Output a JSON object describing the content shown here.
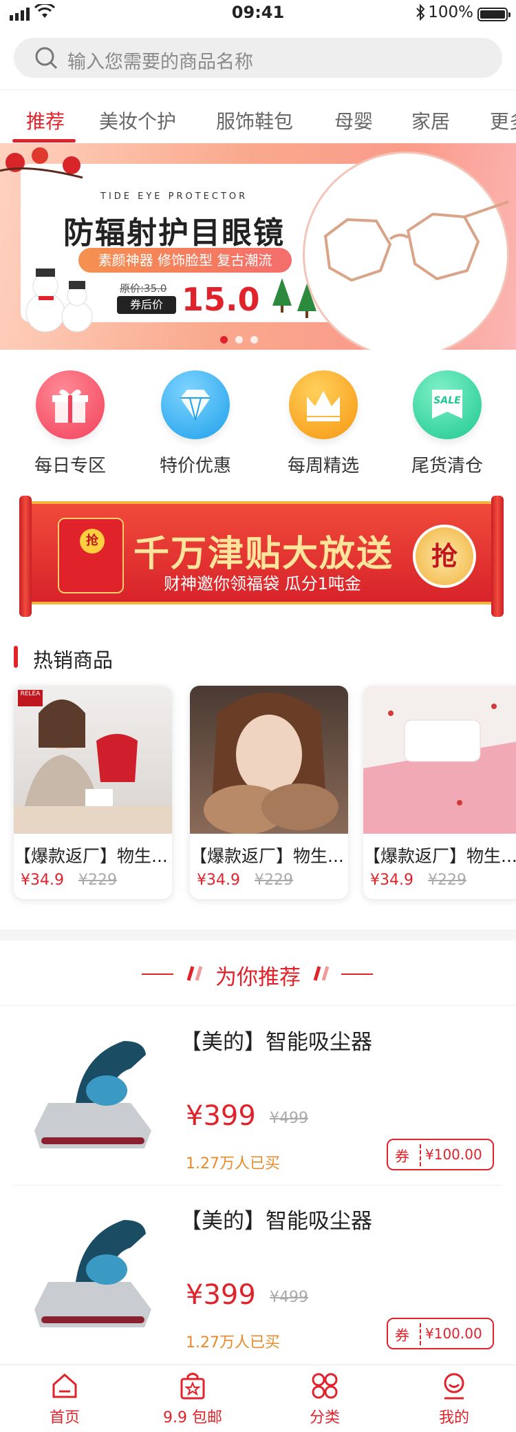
{
  "status_bar": {
    "time": "09:41",
    "battery": "100%"
  },
  "search": {
    "placeholder": "输入您需要的商品名称"
  },
  "tabs": [
    {
      "label": "推荐",
      "active": true
    },
    {
      "label": "美妆个护"
    },
    {
      "label": "服饰鞋包"
    },
    {
      "label": "母婴"
    },
    {
      "label": "家居"
    },
    {
      "label": "更多"
    }
  ],
  "banner": {
    "en_text": "TIDE EYE PROTECTOR",
    "title": "防辐射护目眼镜",
    "tagline": "素颜神器 修饰脸型 复古潮流",
    "original_price": "原价:35.0",
    "after_coupon_label": "券后价",
    "price": "15.0"
  },
  "categories": [
    {
      "label": "每日专区",
      "icon": "gift-icon",
      "color": "#f5546a"
    },
    {
      "label": "特价优惠",
      "icon": "diamond-icon",
      "color": "#2fb2f0"
    },
    {
      "label": "每周精选",
      "icon": "crown-icon",
      "color": "#fba31c"
    },
    {
      "label": "尾货清仓",
      "icon": "sale-tag-icon",
      "color": "#2fd3a0",
      "badge": "SALE"
    }
  ],
  "promo": {
    "envelope_seal": "抢",
    "title": "千万津贴大放送",
    "subtitle": "财神邀你领福袋 瓜分1吨金",
    "grab_label": "抢"
  },
  "hot": {
    "title": "热销商品",
    "items": [
      {
        "name": "【爆款返厂】物生...",
        "price": "¥34.9",
        "old_price": "¥229",
        "brand_tag": "RELEA"
      },
      {
        "name": "【爆款返厂】物生...",
        "price": "¥34.9",
        "old_price": "¥229"
      },
      {
        "name": "【爆款返厂】物生...",
        "price": "¥34.9",
        "old_price": "¥229"
      }
    ]
  },
  "recommend": {
    "title": "为你推荐",
    "items": [
      {
        "name": "【美的】智能吸尘器",
        "price": "¥399",
        "old_price": "¥499",
        "sold": "1.27万人已买",
        "coupon_label": "券",
        "coupon_value": "¥100.00"
      },
      {
        "name": "【美的】智能吸尘器",
        "price": "¥399",
        "old_price": "¥499",
        "sold": "1.27万人已买",
        "coupon_label": "券",
        "coupon_value": "¥100.00"
      }
    ]
  },
  "bottom_nav": [
    {
      "label": "首页",
      "icon": "home-icon"
    },
    {
      "label": "9.9 包邮",
      "icon": "shopping-bag-icon"
    },
    {
      "label": "分类",
      "icon": "category-icon"
    },
    {
      "label": "我的",
      "icon": "profile-icon"
    }
  ],
  "accent_color": "#e0232a"
}
